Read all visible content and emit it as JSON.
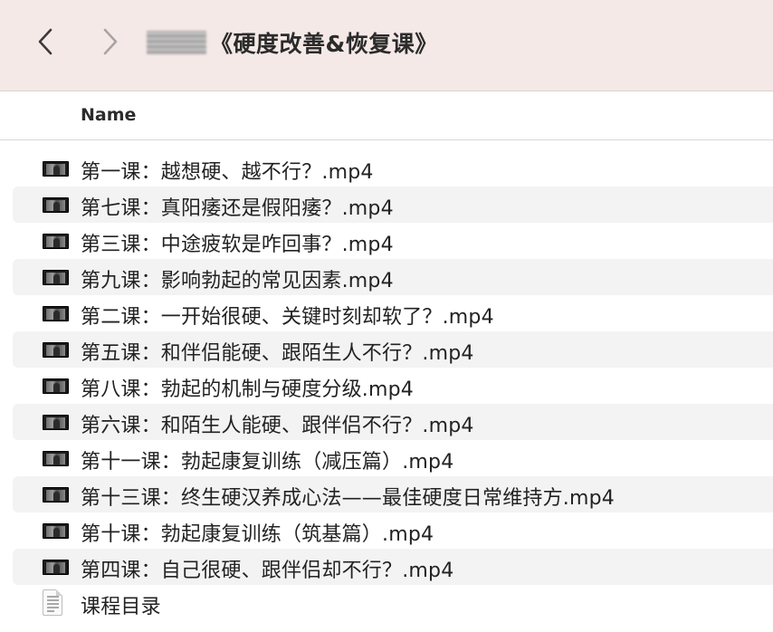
{
  "window": {
    "title": "《硬度改善&恢复课》"
  },
  "list_header": {
    "name_column": "Name"
  },
  "files": [
    {
      "name": "第一课：越想硬、越不行？.mp4",
      "icon": "video-thumbnail-icon"
    },
    {
      "name": "第七课：真阳痿还是假阳痿？.mp4",
      "icon": "video-thumbnail-icon"
    },
    {
      "name": "第三课：中途疲软是咋回事？.mp4",
      "icon": "video-thumbnail-icon"
    },
    {
      "name": "第九课：影响勃起的常见因素.mp4",
      "icon": "video-thumbnail-icon"
    },
    {
      "name": "第二课：一开始很硬、关键时刻却软了？.mp4",
      "icon": "video-thumbnail-icon"
    },
    {
      "name": "第五课：和伴侣能硬、跟陌生人不行？.mp4",
      "icon": "video-thumbnail-icon"
    },
    {
      "name": "第八课：勃起的机制与硬度分级.mp4",
      "icon": "video-thumbnail-icon"
    },
    {
      "name": "第六课：和陌生人能硬、跟伴侣不行？.mp4",
      "icon": "video-thumbnail-icon"
    },
    {
      "name": "第十一课：勃起康复训练（减压篇）.mp4",
      "icon": "video-thumbnail-icon"
    },
    {
      "name": "第十三课：终生硬汉养成心法——最佳硬度日常维持方.mp4",
      "icon": "video-thumbnail-icon"
    },
    {
      "name": "第十课：勃起康复训练（筑基篇）.mp4",
      "icon": "video-thumbnail-icon"
    },
    {
      "name": "第四课：自己很硬、跟伴侣却不行？.mp4",
      "icon": "video-thumbnail-icon"
    },
    {
      "name": "课程目录",
      "icon": "document-icon"
    }
  ],
  "colors": {
    "toolbar_bg": "#f5e9e7",
    "alt_row_bg": "#f3f3f3",
    "text": "#222222"
  }
}
